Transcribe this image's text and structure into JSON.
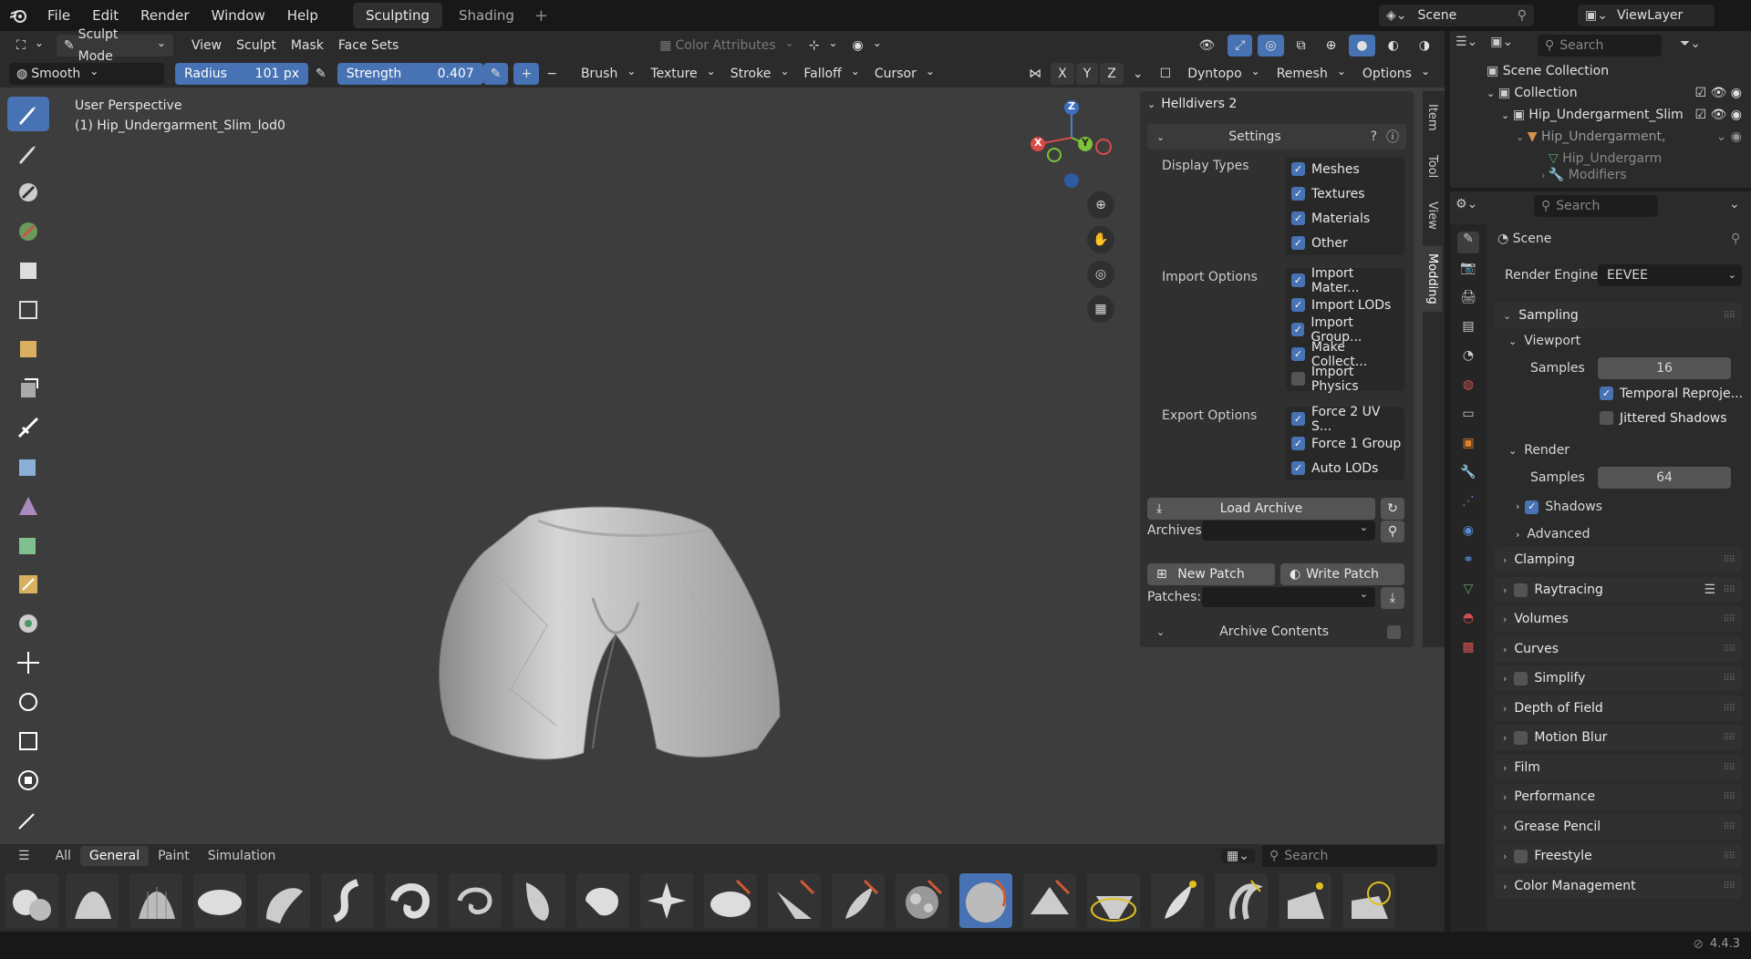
{
  "menu": {
    "items": [
      "File",
      "Edit",
      "Render",
      "Window",
      "Help"
    ]
  },
  "workspaces": [
    {
      "label": "Sculpting",
      "active": true
    },
    {
      "label": "Shading",
      "active": false
    }
  ],
  "scene": {
    "scene_label": "Scene",
    "viewlayer_label": "ViewLayer"
  },
  "header": {
    "mode": "Sculpt Mode",
    "view": "View",
    "sculpt": "Sculpt",
    "mask": "Mask",
    "face_sets": "Face Sets",
    "color_attributes": "Color Attributes"
  },
  "tool_settings": {
    "brush_name": "Smooth",
    "radius_label": "Radius",
    "radius_value": "101 px",
    "strength_label": "Strength",
    "strength_value": "0.407",
    "brush": "Brush",
    "texture": "Texture",
    "stroke": "Stroke",
    "falloff": "Falloff",
    "cursor": "Cursor",
    "axes": [
      "X",
      "Y",
      "Z"
    ],
    "dyntopo": "Dyntopo",
    "remesh": "Remesh",
    "options": "Options"
  },
  "viewport": {
    "perspective": "User Perspective",
    "object": "(1) Hip_Undergarment_Slim_lod0"
  },
  "gizmo": {
    "z": "Z",
    "y": "Y",
    "x": "X"
  },
  "npanel": {
    "title": "Helldivers 2",
    "settings": "Settings",
    "display_types_label": "Display Types",
    "display_types": [
      {
        "label": "Meshes",
        "on": true
      },
      {
        "label": "Textures",
        "on": true
      },
      {
        "label": "Materials",
        "on": true
      },
      {
        "label": "Other",
        "on": true
      }
    ],
    "import_options_label": "Import Options",
    "import_options": [
      {
        "label": "Import Mater...",
        "on": true
      },
      {
        "label": "Import LODs",
        "on": true
      },
      {
        "label": "Import Group...",
        "on": true
      },
      {
        "label": "Make Collect...",
        "on": true
      },
      {
        "label": "Import Physics",
        "on": false
      }
    ],
    "export_options_label": "Export Options",
    "export_options": [
      {
        "label": "Force 2 UV S...",
        "on": true
      },
      {
        "label": "Force 1 Group",
        "on": true
      },
      {
        "label": "Auto LODs",
        "on": true
      }
    ],
    "load_archive": "Load Archive",
    "archives_label": "Archives:",
    "new_patch": "New Patch",
    "write_patch": "Write Patch",
    "patches_label": "Patches:",
    "archive_contents": "Archive Contents",
    "tabs": [
      "Item",
      "Tool",
      "View",
      "Modding"
    ]
  },
  "brush_tabs": {
    "items": [
      "All",
      "General",
      "Paint",
      "Simulation"
    ],
    "search_placeholder": "Search"
  },
  "outliner": {
    "search_placeholder": "Search",
    "rows": [
      "Scene Collection",
      "Collection",
      "Hip_Undergarment_Slim",
      "Hip_Undergarment,",
      "Hip_Undergarm",
      "Modifiers"
    ]
  },
  "properties": {
    "search_placeholder": "Search",
    "context": "Scene",
    "render_engine_label": "Render Engine",
    "render_engine": "EEVEE",
    "sampling": "Sampling",
    "viewport": "Viewport",
    "samples_label": "Samples",
    "viewport_samples": "16",
    "temporal": "Temporal Reproje...",
    "jittered": "Jittered Shadows",
    "render": "Render",
    "render_samples": "64",
    "shadows": "Shadows",
    "advanced": "Advanced",
    "sections": [
      "Clamping",
      "Raytracing",
      "Volumes",
      "Curves",
      "Simplify",
      "Depth of Field",
      "Motion Blur",
      "Film",
      "Performance",
      "Grease Pencil",
      "Freestyle",
      "Color Management"
    ]
  },
  "status": {
    "version": "4.4.3"
  },
  "colors": {
    "accent": "#4772b3",
    "bg": "#3d3d3d",
    "panel": "#2b2b2b"
  }
}
